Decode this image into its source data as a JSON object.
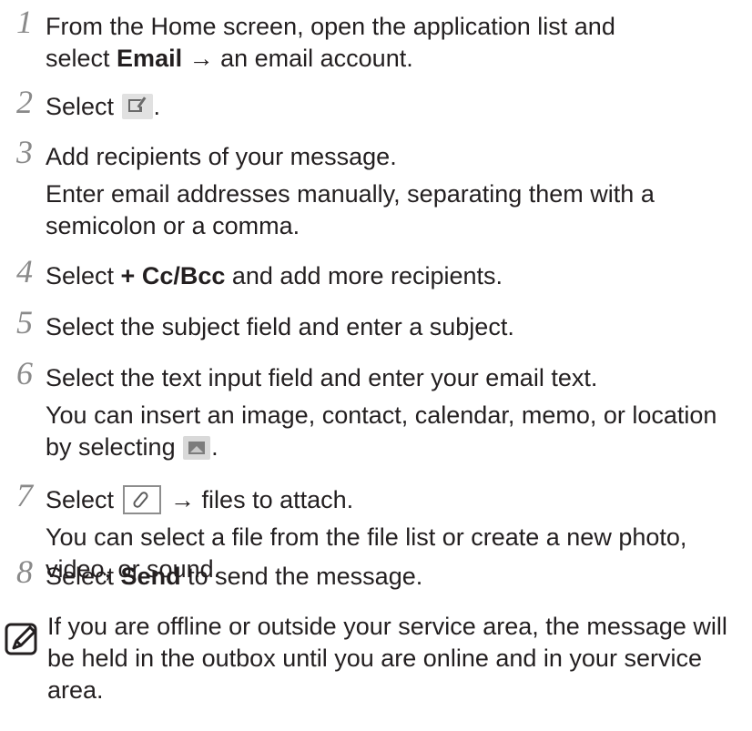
{
  "steps": [
    {
      "num": "1",
      "line1_pre": "From the Home screen, open the application list and",
      "line2_pre": "select ",
      "line2_bold": "Email",
      "line2_post": " → an email account."
    },
    {
      "num": "2",
      "pre": "Select ",
      "icon": "compose-icon",
      "post": "."
    },
    {
      "num": "3",
      "main": "Add recipients of your message.",
      "sub": "Enter email addresses manually, separating them with a semicolon or a comma."
    },
    {
      "num": "4",
      "pre": "Select ",
      "bold": "+ Cc/Bcc",
      "post": " and add more recipients."
    },
    {
      "num": "5",
      "main": "Select the subject field and enter a subject."
    },
    {
      "num": "6",
      "main": "Select the text input field and enter your email text.",
      "sub_pre": "You can insert an image, contact, calendar, memo, or location by selecting ",
      "icon": "image-icon",
      "sub_post": "."
    },
    {
      "num": "7",
      "pre": "Select ",
      "icon": "attach-icon",
      "post": " → files to attach.",
      "sub": "You can select a file from the file list or create a new photo, video, or sound."
    },
    {
      "num": "8",
      "pre": "Select ",
      "bold": "Send",
      "post": " to send the message."
    }
  ],
  "note": {
    "icon": "note-pencil-icon",
    "text": "If you are offline or outside your service area, the message will be held in the outbox until you are online and in your service area."
  }
}
